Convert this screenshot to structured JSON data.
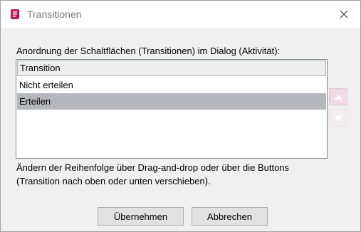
{
  "window": {
    "title": "Transitionen",
    "close_icon": "close-icon",
    "app_icon": "document-icon"
  },
  "instruction": "Anordnung der Schaltflächen (Transitionen) im Dialog (Aktivität):",
  "list": {
    "header": "Transition",
    "items": [
      {
        "label": "Nicht erteilen",
        "selected": false
      },
      {
        "label": "Erteilen",
        "selected": true
      }
    ]
  },
  "controls": {
    "move_up_icon": "arrow-up-icon",
    "move_down_icon": "arrow-down-icon"
  },
  "hint": "Ändern der Reihenfolge über Drag-and-drop oder über die Buttons (Transition nach oben oder unten verschieben).",
  "buttons": {
    "apply": "Übernehmen",
    "cancel": "Abbrechen"
  },
  "colors": {
    "accent": "#c2185b",
    "selection": "#b6b6bd"
  }
}
